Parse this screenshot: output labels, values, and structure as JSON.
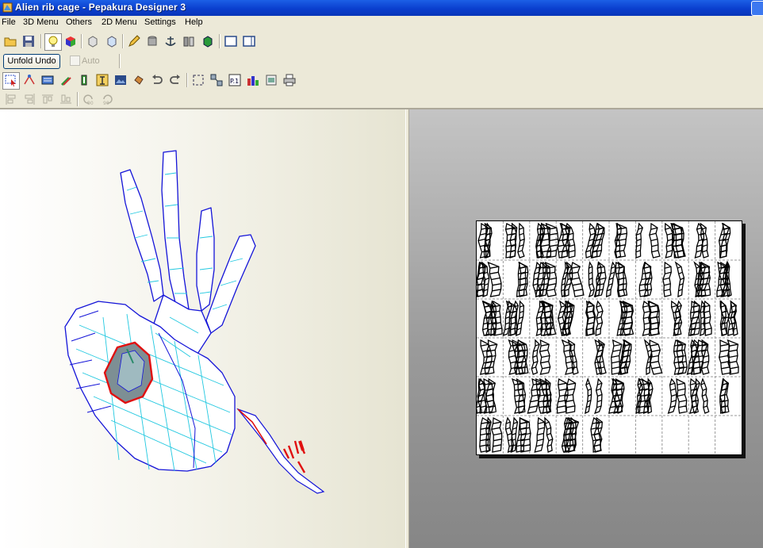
{
  "window": {
    "title": "Alien rib cage - Pepakura Designer 3"
  },
  "menu": {
    "items": [
      "File",
      "3D Menu",
      "Others",
      "2D Menu",
      "Settings",
      "Help"
    ]
  },
  "toolbar": {
    "unfold_undo_label": "Unfold Undo",
    "auto_label": "Auto",
    "auto_checked": false,
    "row1_icons": [
      "open-folder-icon",
      "save-disk-icon",
      "lightbulb-icon",
      "color-cube-icon",
      "cube-front-icon",
      "cube-side-icon",
      "pencil-icon",
      "cylinder-icon",
      "anchor-icon",
      "split-icon",
      "edge-cube-icon",
      "single-pane-icon",
      "dual-pane-icon"
    ],
    "row2_icons": [
      "select-arrow-icon",
      "join-edge-icon",
      "flap-icon",
      "pencil-color-icon",
      "scissors-icon",
      "text-icon",
      "image-icon",
      "move-parts-icon",
      "undo-icon",
      "redo-icon",
      "fit-page-icon",
      "arrange-icon",
      "page-number-icon",
      "print-setup-icon",
      "export-icon",
      "printer-icon"
    ],
    "row3_icons": [
      "align-left-icon",
      "align-center-icon",
      "align-top-icon",
      "align-bottom-icon",
      "rotate-left-90-icon",
      "rotate-right-90-icon"
    ]
  },
  "views": {
    "left": "3d-model-view",
    "right": "2d-pattern-view"
  },
  "pattern_page": {
    "columns": 10,
    "rows": 6
  }
}
